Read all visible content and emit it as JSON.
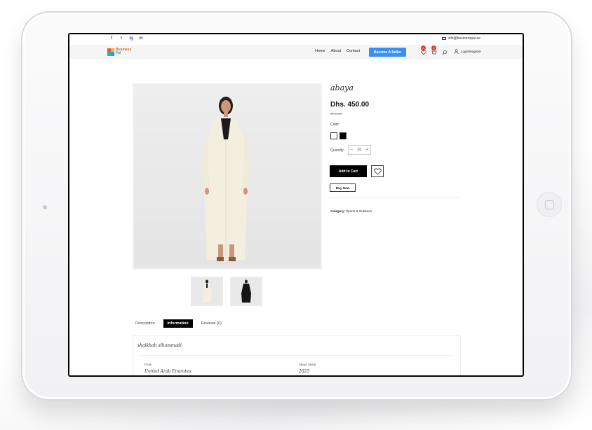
{
  "topbar": {
    "social": [
      "f",
      "t",
      "ig",
      "in"
    ],
    "email": "info@businesspal.ae"
  },
  "brand": {
    "line1": "Business",
    "line2": "Pal"
  },
  "nav": {
    "items": [
      "Home",
      "About",
      "Contact"
    ],
    "seller_button": "Become A Seller",
    "wishlist_count": "0",
    "cart_count": "0",
    "login": "Login/Register"
  },
  "product": {
    "title": "abaya",
    "price": "Dhs. 450.00",
    "old_price": "Dhs.450",
    "color_label": "Color:",
    "colors": [
      "#ffffff",
      "#000000"
    ],
    "quantity_label": "Quantity:",
    "quantity_minus": "−",
    "quantity_value": "01",
    "quantity_plus": "+",
    "add_to_cart": "Add to Cart",
    "buy_now": "Buy Now",
    "category_label": "Category:",
    "category_value": "Sports & Outdoors"
  },
  "tabs": [
    {
      "label": "Description",
      "active": false
    },
    {
      "label": "Information",
      "active": true
    },
    {
      "label": "Reviews (0)",
      "active": false
    }
  ],
  "seller": {
    "name": "shaikhah alhammadi",
    "from_label": "From",
    "from_value": "United Arab Emirates",
    "since_label": "About Since",
    "since_value": "2025"
  },
  "colors": {
    "accent": "#3a8ff7",
    "badge": "#e3342f",
    "dark": "#000000"
  }
}
